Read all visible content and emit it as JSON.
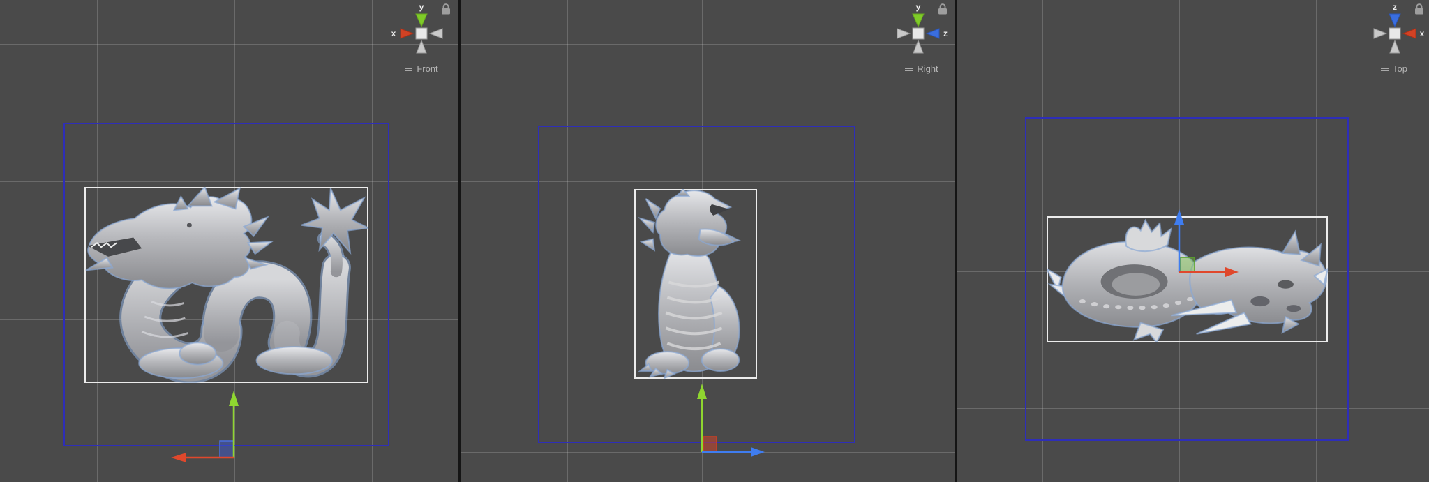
{
  "colors": {
    "background": "#4a4a4a",
    "divider": "#151515",
    "grid_line": "#c8c8c8",
    "selection_box_blue": "#2e2eb8",
    "bounds_box_white": "#ececec",
    "axis_x_red": "#e0482c",
    "axis_y_green": "#8fd630",
    "axis_z_blue": "#3f7df0",
    "gizmo_neutral_cone": "#c9c9c9",
    "view_label_text": "#b6b6b6",
    "lock_icon": "#9e9e9e",
    "model_light": "#e8e9ec",
    "model_mid": "#b7b8bc",
    "model_dark": "#87888c",
    "selection_outline": "#8aa8d4"
  },
  "viewports": [
    {
      "view_label": "Front",
      "orientation_gizmo": {
        "top_axis": {
          "label": "y",
          "axis": "y",
          "color": "#8fd630"
        },
        "side_axis": {
          "label": "x",
          "axis": "x",
          "color": "#e0482c",
          "position": "left"
        },
        "lock_icon": "padlock"
      },
      "move_gizmo": {
        "vertical_arrow": {
          "axis": "y",
          "color": "#8fd630",
          "direction": "up"
        },
        "horizontal_arrow": {
          "axis": "x",
          "color": "#e0482c",
          "direction": "left"
        },
        "plane_handle": {
          "plane": "xy",
          "color": "#4b6fe0"
        }
      },
      "model": "dragon-statue-side-view"
    },
    {
      "view_label": "Right",
      "orientation_gizmo": {
        "top_axis": {
          "label": "y",
          "axis": "y",
          "color": "#8fd630"
        },
        "side_axis": {
          "label": "z",
          "axis": "z",
          "color": "#3f7df0",
          "position": "right"
        },
        "lock_icon": "padlock"
      },
      "move_gizmo": {
        "vertical_arrow": {
          "axis": "y",
          "color": "#8fd630",
          "direction": "up"
        },
        "horizontal_arrow": {
          "axis": "z",
          "color": "#3f7df0",
          "direction": "right"
        },
        "plane_handle": {
          "plane": "yz",
          "color": "#d2442a"
        }
      },
      "model": "dragon-statue-front-view"
    },
    {
      "view_label": "Top",
      "orientation_gizmo": {
        "top_axis": {
          "label": "z",
          "axis": "z",
          "color": "#3f7df0"
        },
        "side_axis": {
          "label": "x",
          "axis": "x",
          "color": "#e0482c",
          "position": "right"
        },
        "lock_icon": "padlock"
      },
      "move_gizmo": {
        "vertical_arrow": {
          "axis": "z",
          "color": "#3f7df0",
          "direction": "up"
        },
        "horizontal_arrow": {
          "axis": "x",
          "color": "#e0482c",
          "direction": "right"
        },
        "plane_handle": {
          "plane": "xz",
          "color": "#58a22a"
        }
      },
      "model": "dragon-statue-top-view"
    }
  ]
}
